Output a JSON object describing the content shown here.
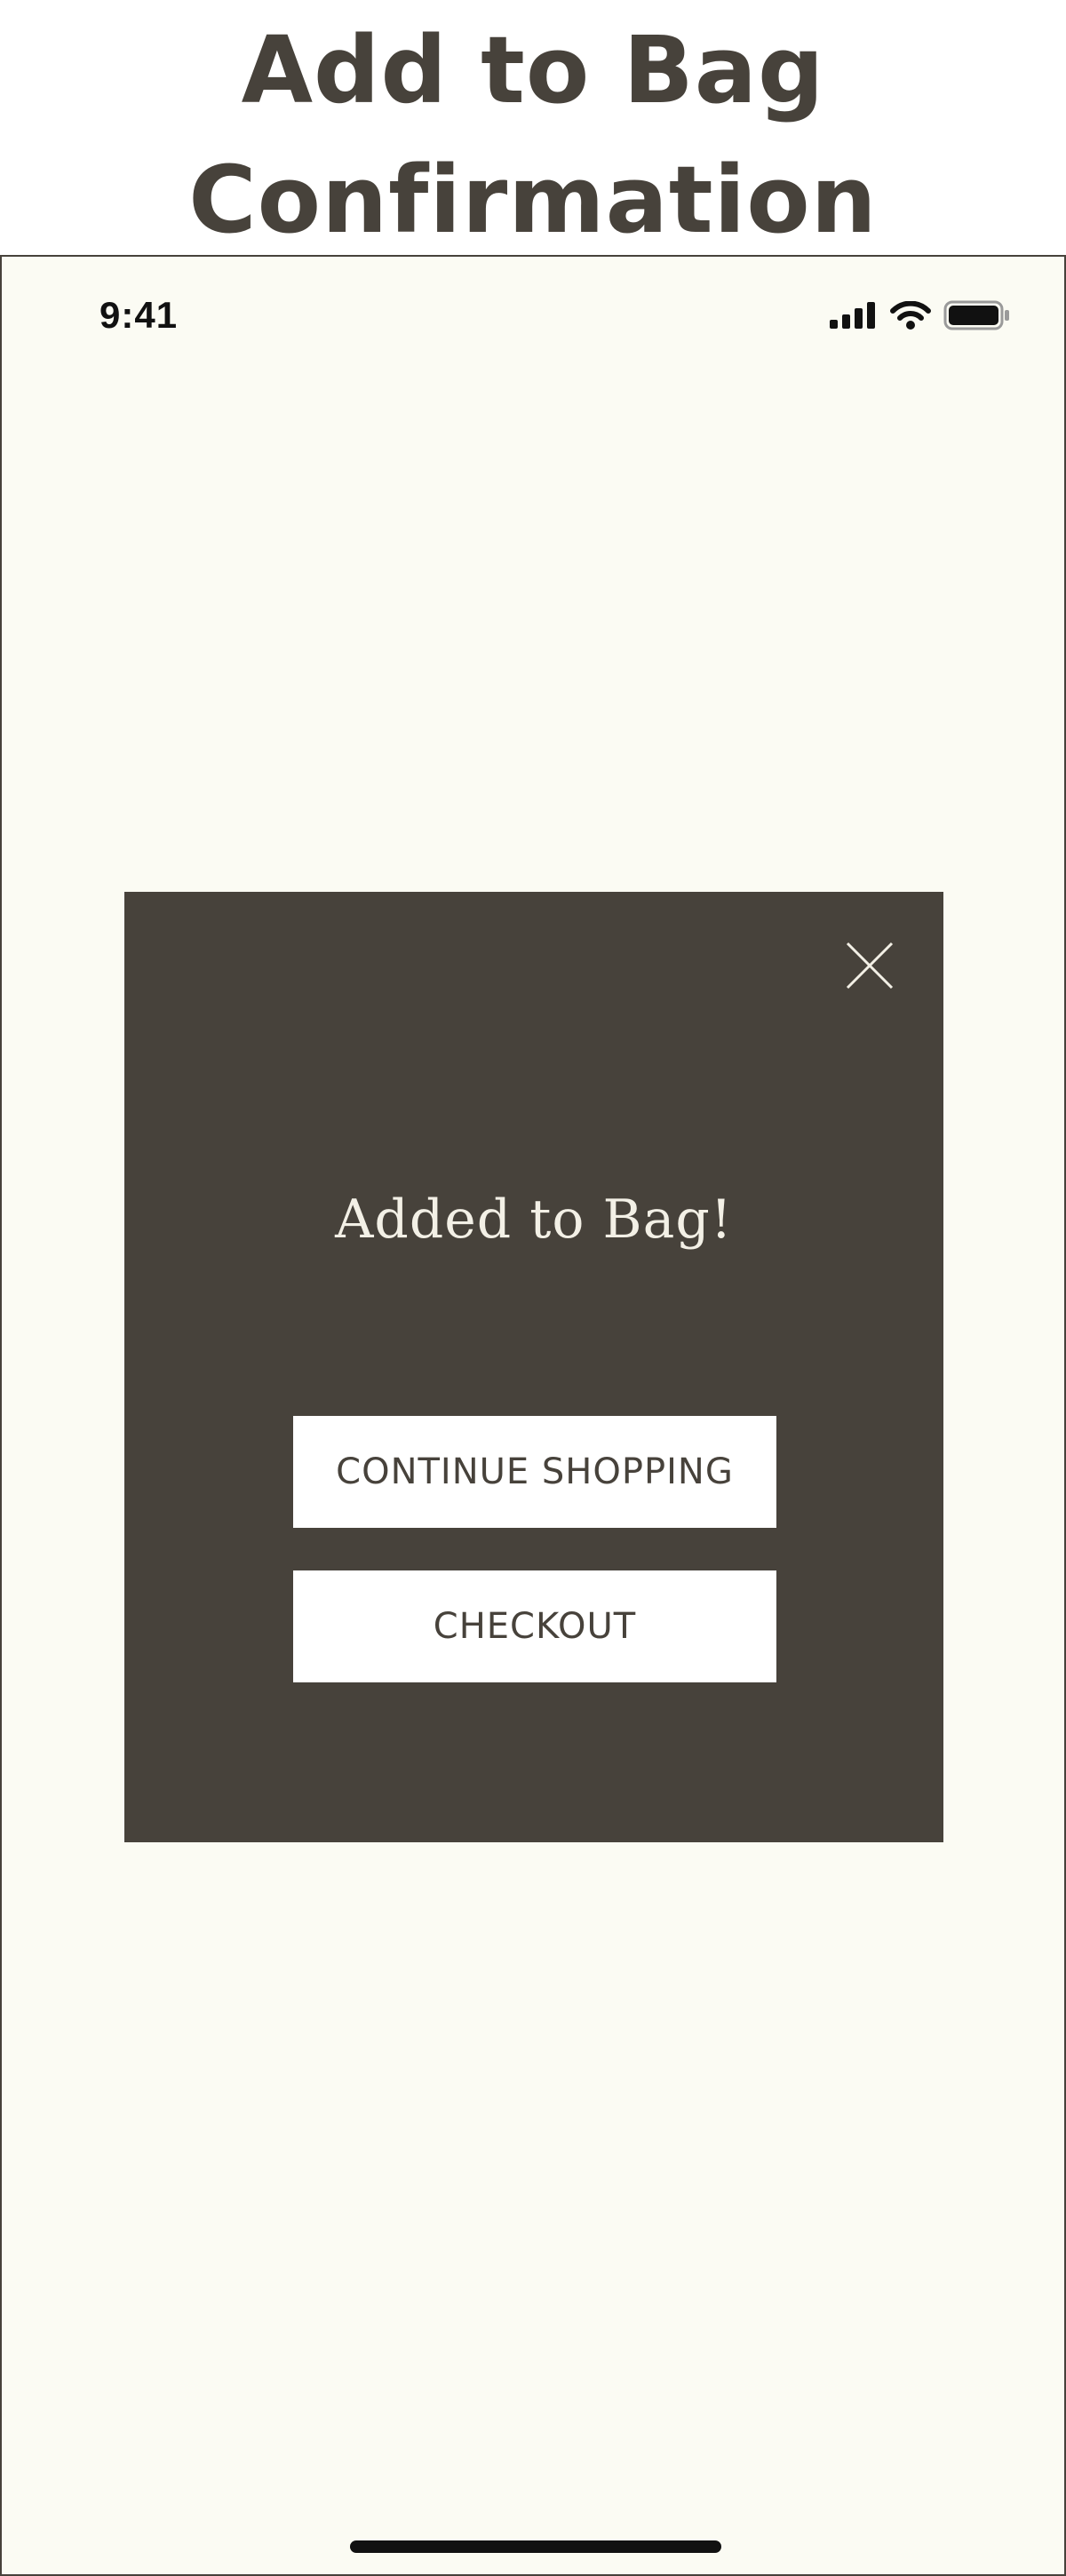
{
  "page": {
    "title_line1": "Add to Bag",
    "title_line2": "Confirmation"
  },
  "status_bar": {
    "time": "9:41",
    "icons": [
      "cellular-signal-icon",
      "wifi-icon",
      "battery-icon"
    ]
  },
  "modal": {
    "close_icon": "close-icon",
    "heading": "Added to Bag!",
    "continue_label": "CONTINUE SHOPPING",
    "checkout_label": "CHECKOUT"
  },
  "colors": {
    "brand_dark": "#47423b",
    "screen_background": "#fbfbf3",
    "button_background": "#ffffff",
    "heading_text": "#f3f0e6"
  }
}
